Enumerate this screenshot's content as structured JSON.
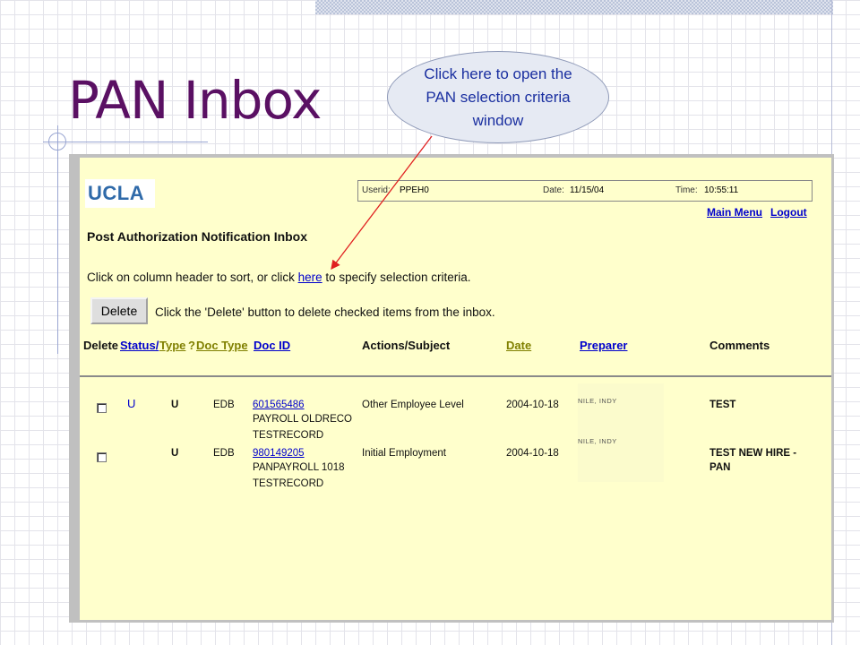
{
  "slide": {
    "title": "PAN Inbox"
  },
  "callout": {
    "text": "Click here to open the PAN selection criteria window"
  },
  "app": {
    "logo": "UCLA",
    "userid_label": "Userid:",
    "userid": "PPEH0",
    "date_label": "Date:",
    "date": "11/15/04",
    "time_label": "Time:",
    "time": "10:55:11",
    "nav": {
      "main_menu": "Main Menu",
      "logout": "Logout"
    },
    "page_title": "Post Authorization Notification Inbox",
    "instruction_pre": "Click on column header to sort, or click",
    "instruction_link": "here",
    "instruction_post": "to specify selection criteria.",
    "delete_button": "Delete",
    "delete_instruction": "Click the 'Delete' button to delete checked items from the inbox."
  },
  "table": {
    "columns": {
      "delete": "Delete",
      "status": "Status/",
      "type": "Type",
      "q": "?",
      "doc_type": "Doc Type",
      "doc_id": "Doc ID",
      "actions": "Actions/Subject",
      "date": "Date",
      "preparer": "Preparer",
      "comments": "Comments"
    },
    "rows": [
      {
        "status": "U",
        "type": "U",
        "doc_type": "EDB",
        "doc_id": "601565486",
        "subject_line1": "PAYROLL OLDRECO",
        "subject_line2": "TESTRECORD",
        "action": "Other Employee Level",
        "date": "2004-10-18",
        "preparer": "NILE, INDY",
        "comments_line1": "TEST",
        "comments_line2": ""
      },
      {
        "status": "",
        "type": "U",
        "doc_type": "EDB",
        "doc_id": "980149205",
        "subject_line1": "PANPAYROLL 1018",
        "subject_line2": "TESTRECORD",
        "action": "Initial Employment",
        "date": "2004-10-18",
        "preparer": "NILE, INDY",
        "comments_line1": "TEST NEW HIRE -",
        "comments_line2": "PAN"
      }
    ]
  },
  "colors": {
    "title": "#5a1063",
    "link": "#0000cc",
    "panel": "#ffffcc",
    "olive": "#808000",
    "arrow": "#e02020"
  }
}
